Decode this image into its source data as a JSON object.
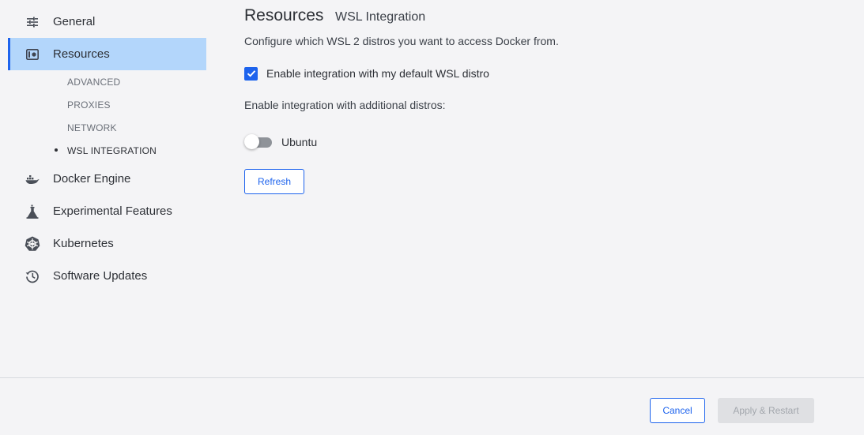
{
  "sidebar": {
    "items": [
      {
        "label": "General",
        "icon": "sliders-icon"
      },
      {
        "label": "Resources",
        "icon": "resources-icon",
        "active": true
      },
      {
        "label": "Docker Engine",
        "icon": "whale-icon"
      },
      {
        "label": "Experimental Features",
        "icon": "flask-icon"
      },
      {
        "label": "Kubernetes",
        "icon": "kubernetes-icon"
      },
      {
        "label": "Software Updates",
        "icon": "history-icon"
      }
    ],
    "sub_items": [
      {
        "label": "ADVANCED"
      },
      {
        "label": "PROXIES"
      },
      {
        "label": "NETWORK"
      },
      {
        "label": "WSL INTEGRATION",
        "current": true
      }
    ]
  },
  "main": {
    "title": "Resources",
    "subtitle": "WSL Integration",
    "description": "Configure which WSL 2 distros you want to access Docker from.",
    "default_distro": {
      "label": "Enable integration with my default WSL distro",
      "checked": true
    },
    "additional_label": "Enable integration with additional distros:",
    "distros": [
      {
        "name": "Ubuntu",
        "enabled": false
      }
    ],
    "refresh_label": "Refresh"
  },
  "footer": {
    "cancel_label": "Cancel",
    "apply_label": "Apply & Restart",
    "apply_disabled": true
  },
  "colors": {
    "accent": "#1d63ed",
    "active_bg": "#b3d6fb",
    "background": "#f4f4f6"
  }
}
